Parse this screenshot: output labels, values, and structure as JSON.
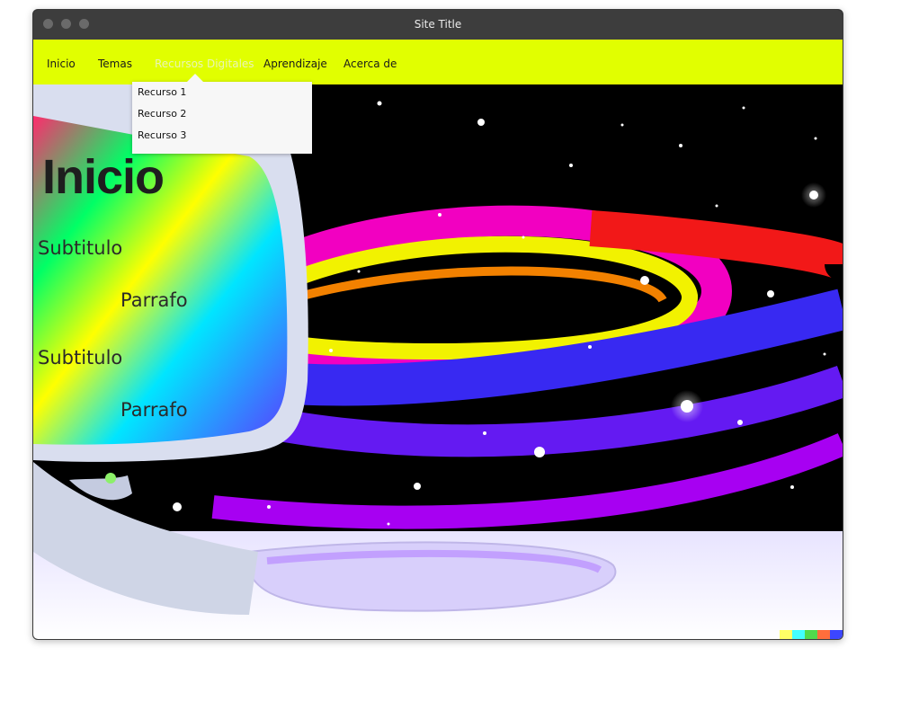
{
  "window": {
    "title": "Site Title"
  },
  "nav": {
    "items": [
      "Inicio",
      "Temas",
      "Recursos Digitales",
      "Aprendizaje",
      "Acerca de"
    ],
    "active": "Recursos Digitales"
  },
  "dropdown": {
    "items": [
      "Recurso 1",
      "Recurso 2",
      "Recurso 3"
    ]
  },
  "page": {
    "heading": "Inicio",
    "sections": [
      {
        "subtitle": "Subtitulo",
        "paragraph": "Parrafo"
      },
      {
        "subtitle": "Subtitulo",
        "paragraph": "Parrafo"
      }
    ]
  },
  "colors": {
    "navbar": "#e1ff00",
    "titlebar": "#3d3d3d",
    "watermark": [
      "#ffff66",
      "#42ffff",
      "#51da4c",
      "#ff6e3c",
      "#3c46ff"
    ]
  },
  "hero_image": {
    "description_icon": "computer-monitor-rainbow-space-illustration"
  }
}
